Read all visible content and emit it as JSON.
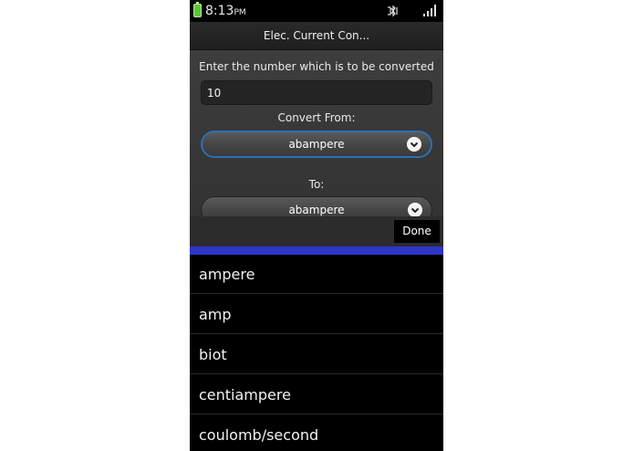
{
  "status_bar": {
    "time": "8:13",
    "ampm": "PM",
    "battery_color": "#62c43a"
  },
  "title_bar": {
    "title": "Elec. Current Con..."
  },
  "form": {
    "prompt": "Enter the number which is to be converted",
    "number_value": "10",
    "from_label": "Convert From:",
    "from_value": "abampere",
    "to_label": "To:",
    "to_value": "abampere"
  },
  "picker": {
    "done_label": "Done",
    "accent_color": "#2f35c9",
    "items": [
      "ampere",
      "amp",
      "biot",
      "centiampere",
      "coulomb/second"
    ]
  }
}
